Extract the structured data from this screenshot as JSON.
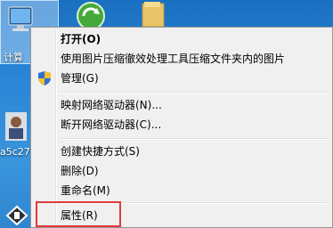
{
  "desktop": {
    "icons": [
      {
        "label": "计算",
        "icon": "computer-icon"
      },
      {
        "label": "",
        "icon": "recycle-icon"
      },
      {
        "label": "",
        "icon": "folder-icon"
      },
      {
        "label": "a5c27",
        "icon": "photo-icon"
      }
    ]
  },
  "context_menu": {
    "items": [
      {
        "label": "打开(O)",
        "bold": true
      },
      {
        "label": "使用图片压缩徹效处理工具压缩文件夹内的图片"
      },
      {
        "label": "管理(G)",
        "icon": "shield-icon"
      },
      {
        "label": "映射网络驱动器(N)..."
      },
      {
        "label": "断开网络驱动器(C)..."
      },
      {
        "label": "创建快捷方式(S)"
      },
      {
        "label": "删除(D)"
      },
      {
        "label": "重命名(M)"
      },
      {
        "label": "属性(R)"
      }
    ]
  },
  "colors": {
    "highlight_border": "#e03b3b",
    "menu_bg": "#f0f0f0",
    "desktop_bg": "#2a86d6"
  }
}
